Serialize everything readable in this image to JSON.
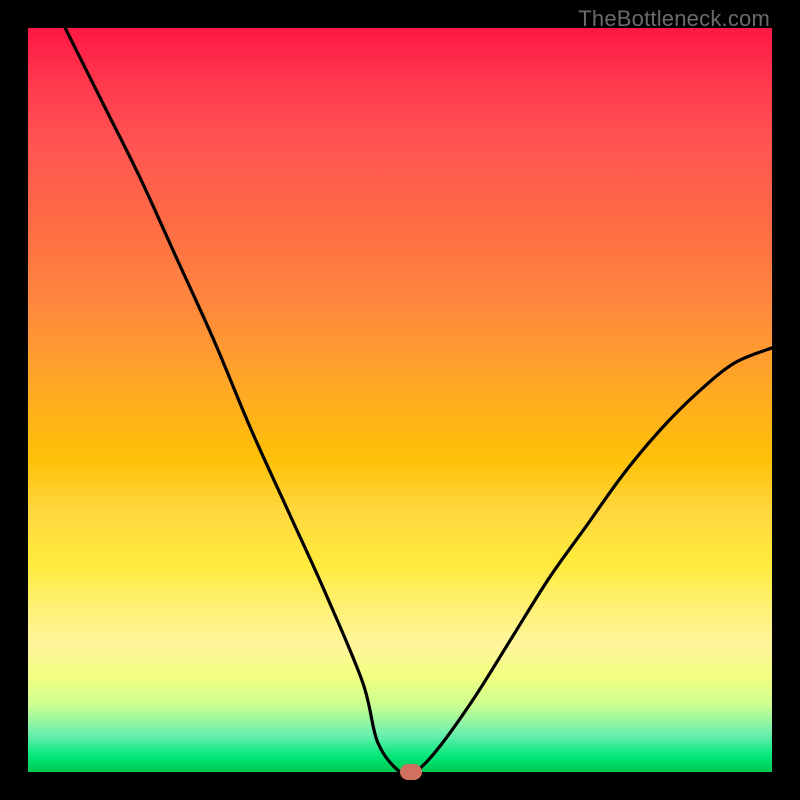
{
  "attribution": "TheBottleneck.com",
  "chart_data": {
    "type": "line",
    "title": "",
    "xlabel": "",
    "ylabel": "",
    "xlim": [
      0,
      100
    ],
    "ylim": [
      0,
      100
    ],
    "grid": false,
    "legend": false,
    "background_gradient": [
      {
        "stop": 0,
        "color": "#ff1744"
      },
      {
        "stop": 50,
        "color": "#ffc107"
      },
      {
        "stop": 75,
        "color": "#ffeb3b"
      },
      {
        "stop": 100,
        "color": "#00c853"
      }
    ],
    "series": [
      {
        "name": "bottleneck-curve",
        "x": [
          5,
          10,
          15,
          20,
          25,
          30,
          35,
          40,
          45,
          47,
          50,
          52,
          55,
          60,
          65,
          70,
          75,
          80,
          85,
          90,
          95,
          100
        ],
        "y": [
          100,
          90,
          80,
          69,
          58,
          46,
          35,
          24,
          12,
          4,
          0,
          0,
          3,
          10,
          18,
          26,
          33,
          40,
          46,
          51,
          55,
          57
        ]
      }
    ],
    "marker": {
      "x": 51.5,
      "y": 0,
      "color": "#d07060"
    }
  }
}
